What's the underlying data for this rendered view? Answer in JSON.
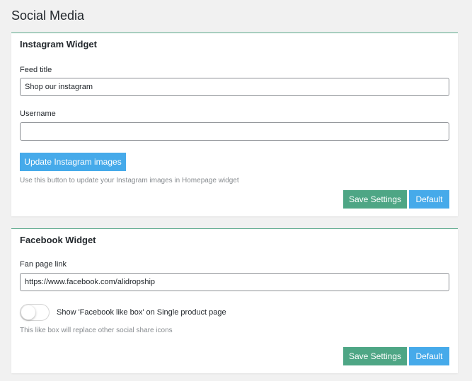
{
  "page": {
    "title": "Social Media"
  },
  "instagram": {
    "title": "Instagram Widget",
    "feed_title_label": "Feed title",
    "feed_title_value": "Shop our instagram",
    "username_label": "Username",
    "username_value": "",
    "update_button": "Update Instagram images",
    "help_text": "Use this button to update your Instagram images in Homepage widget",
    "save_button": "Save Settings",
    "default_button": "Default"
  },
  "facebook": {
    "title": "Facebook Widget",
    "fan_page_label": "Fan page link",
    "fan_page_value": "https://www.facebook.com/alidropship",
    "like_box_toggle_label": "Show 'Facebook like box' on Single product page",
    "like_box_enabled": false,
    "help_text": "This like box will replace other social share icons",
    "save_button": "Save Settings",
    "default_button": "Default"
  },
  "colors": {
    "accent_blue": "#46aaea",
    "accent_green": "#4ea685",
    "panel_border": "#5aa98b"
  }
}
